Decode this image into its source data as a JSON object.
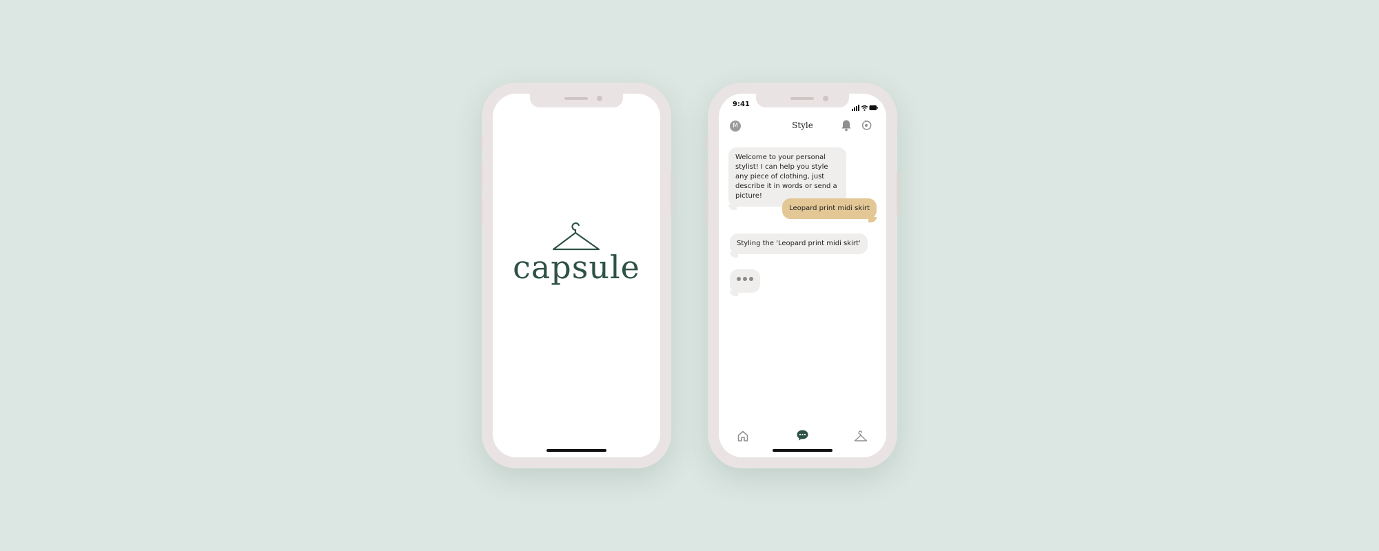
{
  "splash": {
    "logo_text": "capsule",
    "brand_color": "#2e5146",
    "logo_icon": "hanger-icon"
  },
  "chat_screen": {
    "status_bar": {
      "time": "9:41",
      "icons": [
        "signal-icon",
        "wifi-icon",
        "battery-icon"
      ]
    },
    "header": {
      "avatar_initial": "M",
      "title": "Style",
      "icons": [
        "bell-icon",
        "refresh-icon"
      ]
    },
    "messages": [
      {
        "sender": "bot",
        "text": "Welcome to your personal stylist! I can help you style any piece of clothing, just describe it in words or send a picture!"
      },
      {
        "sender": "user",
        "text": "Leopard print midi skirt"
      },
      {
        "sender": "bot",
        "text": "Styling the 'Leopard print midi skirt'"
      },
      {
        "sender": "bot",
        "typing": true
      }
    ],
    "tab_bar": {
      "items": [
        "home-icon",
        "chat-icon",
        "hanger-icon"
      ],
      "active_index": 1
    },
    "colors": {
      "user_bubble": "#e3c896",
      "bot_bubble": "#efeeed",
      "accent": "#2e5146"
    }
  }
}
